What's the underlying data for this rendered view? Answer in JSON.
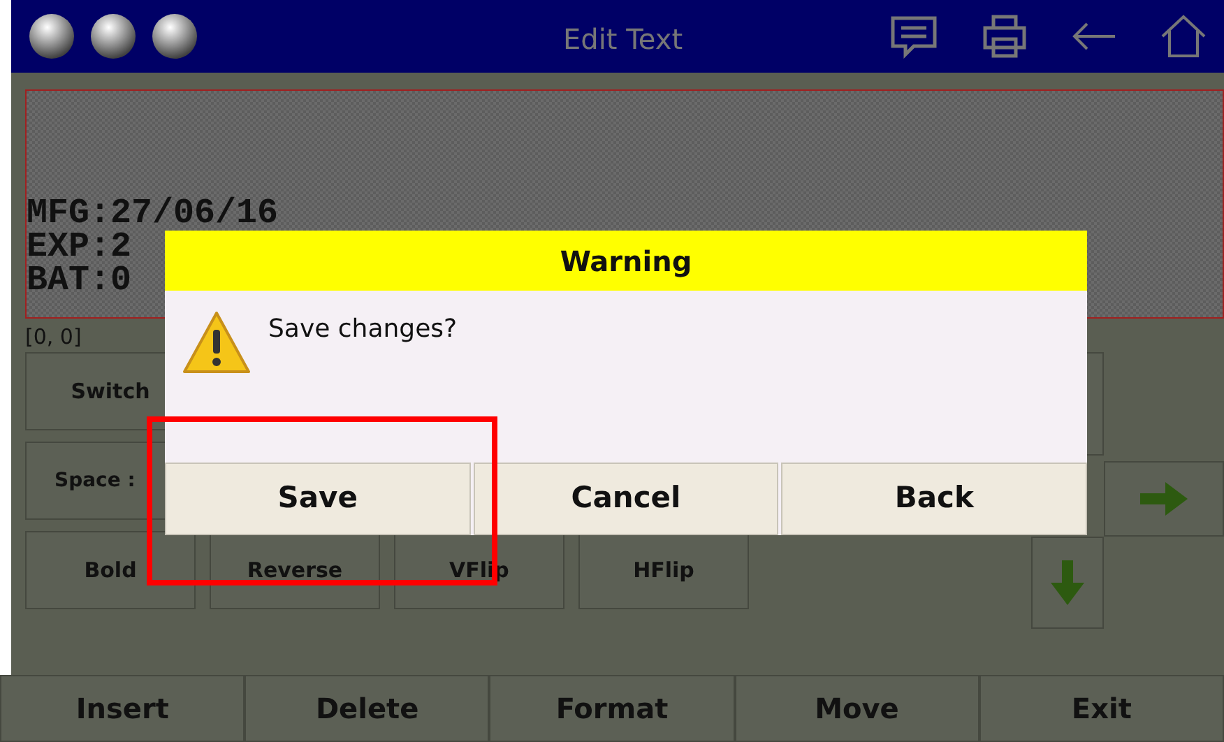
{
  "window": {
    "title": "Edit Text"
  },
  "canvas": {
    "lines": [
      "MFG:27/06/16",
      "EXP:2",
      "BAT:0"
    ],
    "cursor": "[0, 0]"
  },
  "tool_rows": [
    [
      "Switch"
    ],
    [
      "Space :"
    ],
    [
      "Bold",
      "Reverse",
      "VFlip",
      "HFlip"
    ]
  ],
  "bottom_bar": [
    "Insert",
    "Delete",
    "Format",
    "Move",
    "Exit"
  ],
  "dialog": {
    "title": "Warning",
    "message": "Save changes?",
    "buttons": [
      "Save",
      "Cancel",
      "Back"
    ]
  }
}
